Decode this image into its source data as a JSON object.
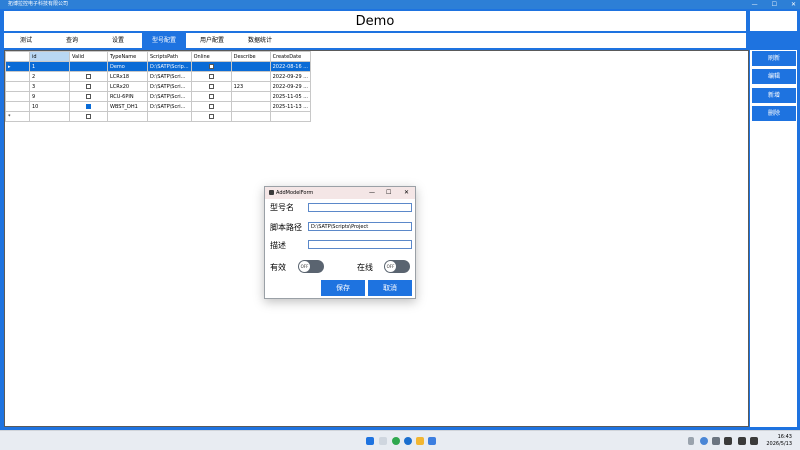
{
  "window": {
    "title": "拓博拉控电子科技有限公司",
    "min": "—",
    "max": "☐",
    "close": "✕"
  },
  "header": {
    "title": "Demo"
  },
  "tabs": [
    {
      "label": "测试"
    },
    {
      "label": "查询"
    },
    {
      "label": "设置"
    },
    {
      "label": "型号配置"
    },
    {
      "label": "用户配置"
    },
    {
      "label": "数据统计"
    }
  ],
  "side_buttons": {
    "refresh": "刷新",
    "edit": "编辑",
    "add": "新增",
    "delete": "删除"
  },
  "grid": {
    "columns": [
      "id",
      "Valid",
      "TypeName",
      "ScriptsPath",
      "Online",
      "Describe",
      "CreateDate"
    ],
    "rows": [
      {
        "marker": "▸",
        "id": "1",
        "valid": true,
        "type": "Demo",
        "path": "D:\\SATP\\Scrip...",
        "online": false,
        "desc": "",
        "date": "2022-08-16 ..."
      },
      {
        "marker": "",
        "id": "2",
        "valid": false,
        "type": "LCRx18",
        "path": "D:\\SATP\\Scri...",
        "online": false,
        "desc": "",
        "date": "2022-09-29 ..."
      },
      {
        "marker": "",
        "id": "3",
        "valid": false,
        "type": "LCRx20",
        "path": "D:\\SATP\\Scri...",
        "online": false,
        "desc": "123",
        "date": "2022-09-29 ..."
      },
      {
        "marker": "",
        "id": "9",
        "valid": false,
        "type": "RCU-6PIN",
        "path": "D:\\SATP\\Scri...",
        "online": false,
        "desc": "",
        "date": "2025-11-05 ..."
      },
      {
        "marker": "",
        "id": "10",
        "valid": true,
        "type": "WBST_DH1",
        "path": "D:\\SATP\\Scri...",
        "online": false,
        "desc": "",
        "date": "2025-11-13 ..."
      },
      {
        "marker": "*",
        "id": "",
        "valid": false,
        "type": "",
        "path": "",
        "online": false,
        "desc": "",
        "date": ""
      }
    ]
  },
  "dialog": {
    "title": "AddModelForm",
    "min": "—",
    "max": "☐",
    "close": "✕",
    "type_label": "型号名",
    "type_value": "",
    "path_label": "脚本路径",
    "path_value": "D:\\SATP\\Scripts\\Project",
    "desc_label": "描述",
    "desc_value": "",
    "valid_label": "有效",
    "online_label": "在线",
    "valid_toggle": "OFF",
    "online_toggle": "OFF",
    "save": "保存",
    "cancel": "取消"
  },
  "taskbar": {
    "time": "16:43",
    "date": "2026/5/13"
  },
  "colors": {
    "accent": "#1e73e0",
    "selected_row": "#0a6bd6",
    "header_selected": "#b9d7f3"
  }
}
